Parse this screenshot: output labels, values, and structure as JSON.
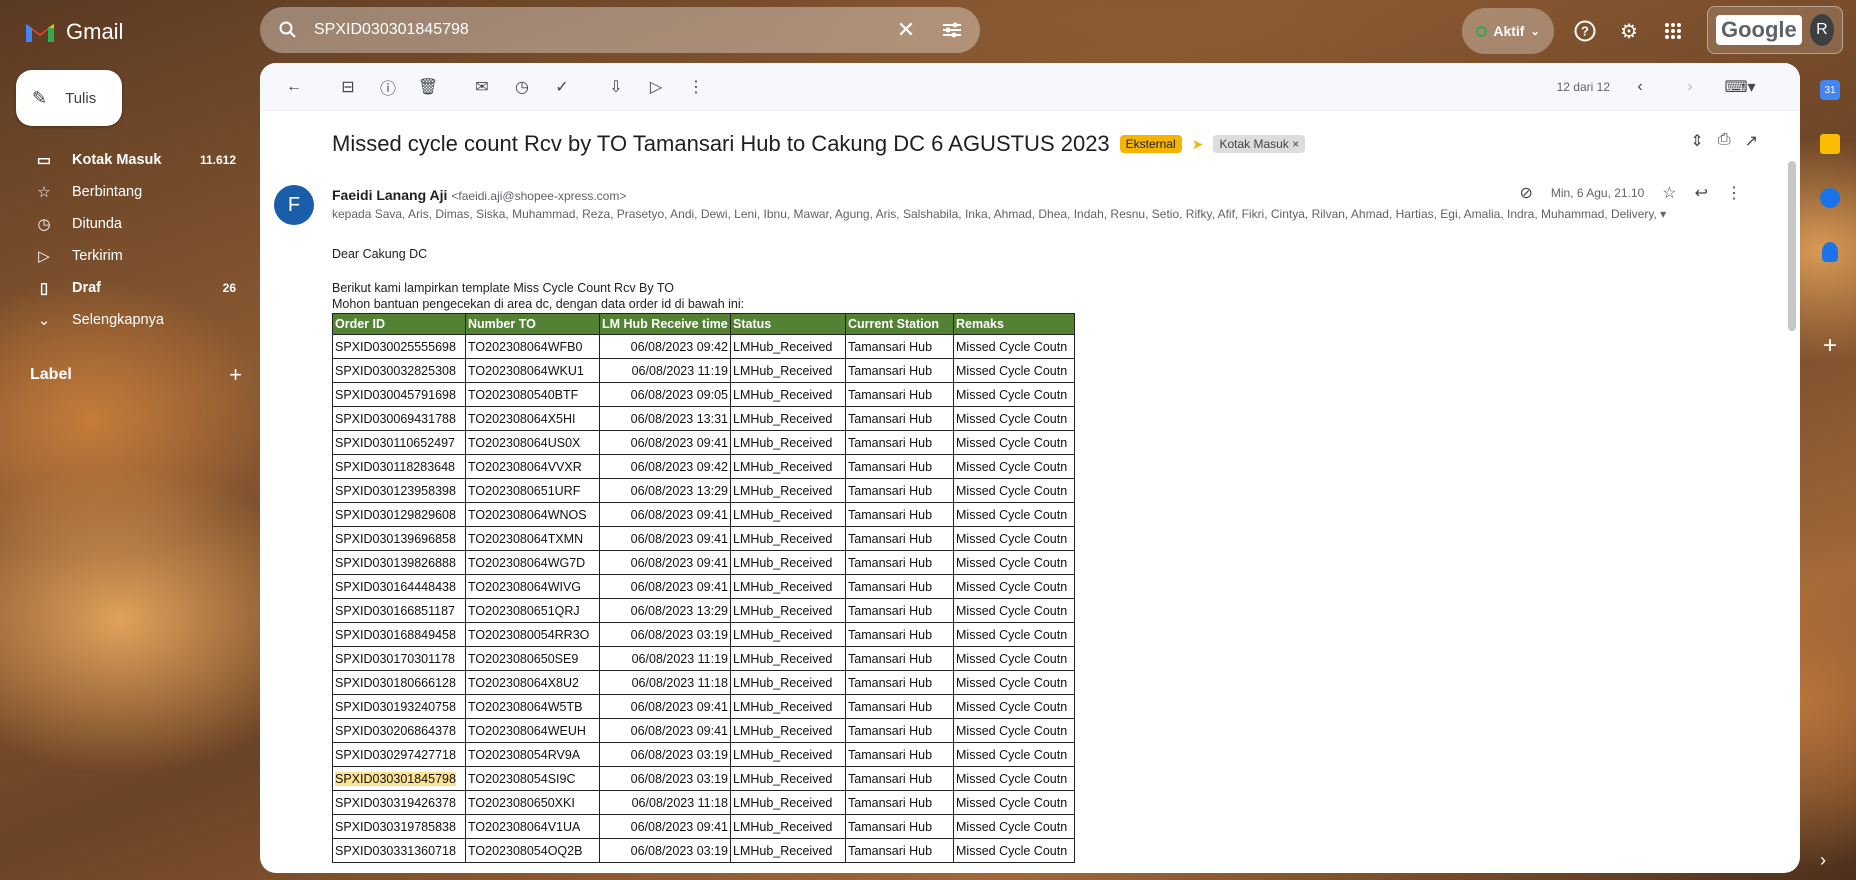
{
  "app": {
    "name": "Gmail",
    "search_query": "SPXID030301845798",
    "status_label": "Aktif",
    "google_word": "Google",
    "avatar_initial": "R"
  },
  "icons": {
    "search": "search-icon",
    "clear": "close-icon",
    "filter": "tune-icon",
    "help": "help-icon",
    "settings": "gear-icon",
    "apps": "apps-grid-icon"
  },
  "compose_label": "Tulis",
  "nav": [
    {
      "label": "Kotak Masuk",
      "count": "11.612",
      "icon": "inbox-icon",
      "glyph": "▭"
    },
    {
      "label": "Berbintang",
      "count": "",
      "icon": "star-icon",
      "glyph": "☆"
    },
    {
      "label": "Ditunda",
      "count": "",
      "icon": "clock-icon",
      "glyph": "◷"
    },
    {
      "label": "Terkirim",
      "count": "",
      "icon": "send-icon",
      "glyph": "▷"
    },
    {
      "label": "Draf",
      "count": "26",
      "icon": "draft-icon",
      "glyph": "▯"
    },
    {
      "label": "Selengkapnya",
      "count": "",
      "icon": "chevron-down-icon",
      "glyph": "⌄"
    }
  ],
  "label_header": "Label",
  "toolbar": {
    "pagination": "12 dari 12"
  },
  "email": {
    "subject": "Missed cycle count Rcv by TO Tamansari Hub to Cakung DC 6 AGUSTUS 2023",
    "tag_external": "Eksternal",
    "tag_inbox": "Kotak Masuk",
    "sender_initial": "F",
    "sender_name": "Faeidi Lanang Aji",
    "sender_email": "<faeidi.aji@shopee-xpress.com>",
    "date": "Min, 6 Agu, 21.10",
    "recipients": "kepada Sava, Aris, Dimas, Siska, Muhammad, Reza, Prasetyo, Andi, Dewi, Leni, Ibnu, Mawar, Agung, Aris, Salshabila, Inka, Ahmad, Dhea, Indah, Resnu, Setio, Rifky, Afif, Fikri, Cintya, Rilvan, Ahmad, Hartias, Egi, Amalia, Indra, Muhammad, Delivery,",
    "greeting": "Dear Cakung DC",
    "line1": "Berikut kami lampirkan template Miss Cycle Count Rcv By TO",
    "line2": "Mohon bantuan pengecekan di area dc, dengan data order id di bawah ini:"
  },
  "table": {
    "headers": [
      "Order ID",
      "Number TO",
      "LM Hub Receive time",
      "Status",
      "Current Station",
      "Remaks"
    ],
    "rows": [
      [
        "SPXID030025555698",
        "TO202308064WFB0",
        "06/08/2023 09:42",
        "LMHub_Received",
        "Tamansari Hub",
        "Missed Cycle Coutn"
      ],
      [
        "SPXID030032825308",
        "TO202308064WKU1",
        "06/08/2023 11:19",
        "LMHub_Received",
        "Tamansari Hub",
        "Missed Cycle Coutn"
      ],
      [
        "SPXID030045791698",
        "TO2023080540BTF",
        "06/08/2023 09:05",
        "LMHub_Received",
        "Tamansari Hub",
        "Missed Cycle Coutn"
      ],
      [
        "SPXID030069431788",
        "TO202308064X5HI",
        "06/08/2023 13:31",
        "LMHub_Received",
        "Tamansari Hub",
        "Missed Cycle Coutn"
      ],
      [
        "SPXID030110652497",
        "TO202308064US0X",
        "06/08/2023 09:41",
        "LMHub_Received",
        "Tamansari Hub",
        "Missed Cycle Coutn"
      ],
      [
        "SPXID030118283648",
        "TO202308064VVXR",
        "06/08/2023 09:42",
        "LMHub_Received",
        "Tamansari Hub",
        "Missed Cycle Coutn"
      ],
      [
        "SPXID030123958398",
        "TO2023080651URF",
        "06/08/2023 13:29",
        "LMHub_Received",
        "Tamansari Hub",
        "Missed Cycle Coutn"
      ],
      [
        "SPXID030129829608",
        "TO202308064WNOS",
        "06/08/2023 09:41",
        "LMHub_Received",
        "Tamansari Hub",
        "Missed Cycle Coutn"
      ],
      [
        "SPXID030139696858",
        "TO202308064TXMN",
        "06/08/2023 09:41",
        "LMHub_Received",
        "Tamansari Hub",
        "Missed Cycle Coutn"
      ],
      [
        "SPXID030139826888",
        "TO202308064WG7D",
        "06/08/2023 09:41",
        "LMHub_Received",
        "Tamansari Hub",
        "Missed Cycle Coutn"
      ],
      [
        "SPXID030164448438",
        "TO202308064WIVG",
        "06/08/2023 09:41",
        "LMHub_Received",
        "Tamansari Hub",
        "Missed Cycle Coutn"
      ],
      [
        "SPXID030166851187",
        "TO2023080651QRJ",
        "06/08/2023 13:29",
        "LMHub_Received",
        "Tamansari Hub",
        "Missed Cycle Coutn"
      ],
      [
        "SPXID030168849458",
        "TO2023080054RR3O",
        "06/08/2023 03:19",
        "LMHub_Received",
        "Tamansari Hub",
        "Missed Cycle Coutn"
      ],
      [
        "SPXID030170301178",
        "TO2023080650SE9",
        "06/08/2023 11:19",
        "LMHub_Received",
        "Tamansari Hub",
        "Missed Cycle Coutn"
      ],
      [
        "SPXID030180666128",
        "TO202308064X8U2",
        "06/08/2023 11:18",
        "LMHub_Received",
        "Tamansari Hub",
        "Missed Cycle Coutn"
      ],
      [
        "SPXID030193240758",
        "TO202308064W5TB",
        "06/08/2023 09:41",
        "LMHub_Received",
        "Tamansari Hub",
        "Missed Cycle Coutn"
      ],
      [
        "SPXID030206864378",
        "TO202308064WEUH",
        "06/08/2023 09:41",
        "LMHub_Received",
        "Tamansari Hub",
        "Missed Cycle Coutn"
      ],
      [
        "SPXID030297427718",
        "TO202308054RV9A",
        "06/08/2023 03:19",
        "LMHub_Received",
        "Tamansari Hub",
        "Missed Cycle Coutn"
      ],
      [
        "SPXID030301845798",
        "TO202308054SI9C",
        "06/08/2023 03:19",
        "LMHub_Received",
        "Tamansari Hub",
        "Missed Cycle Coutn"
      ],
      [
        "SPXID030319426378",
        "TO2023080650XKI",
        "06/08/2023 11:18",
        "LMHub_Received",
        "Tamansari Hub",
        "Missed Cycle Coutn"
      ],
      [
        "SPXID030319785838",
        "TO202308064V1UA",
        "06/08/2023 09:41",
        "LMHub_Received",
        "Tamansari Hub",
        "Missed Cycle Coutn"
      ],
      [
        "SPXID030331360718",
        "TO202308054OQ2B",
        "06/08/2023 03:19",
        "LMHub_Received",
        "Tamansari Hub",
        "Missed Cycle Coutn"
      ]
    ],
    "highlighted_row": 18,
    "highlight_color": "#fde293",
    "header_color": "#548235"
  },
  "colors": {
    "accent_tag": "#f4b400",
    "sender_avatar": "#1a5da8",
    "status_dot": "#34a853"
  }
}
